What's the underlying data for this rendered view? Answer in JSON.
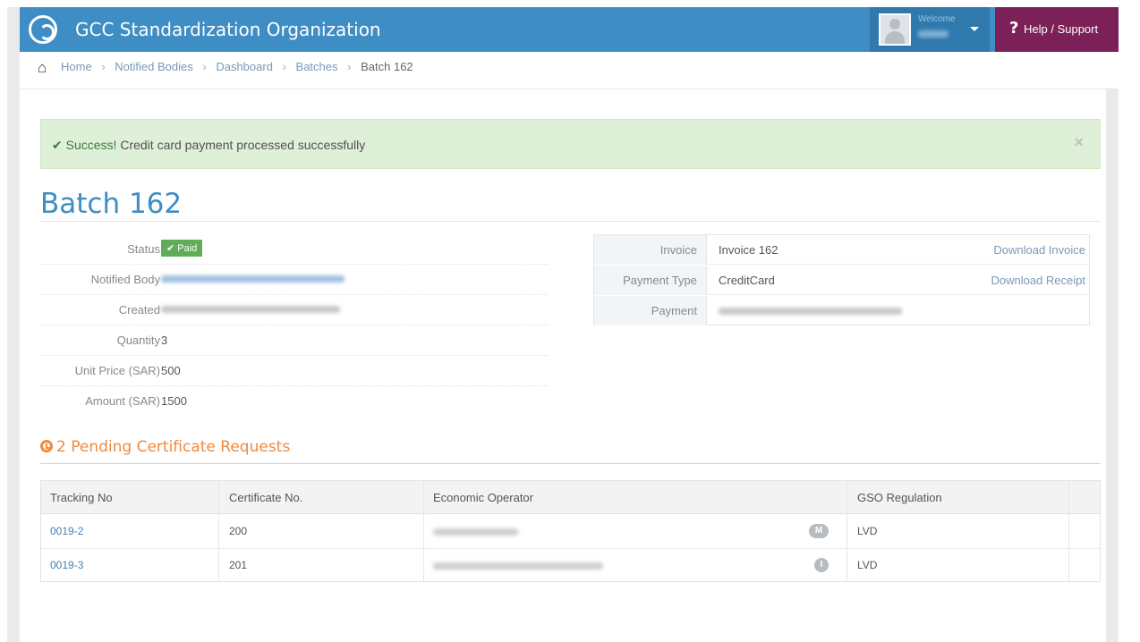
{
  "header": {
    "app_title": "GCC Standardization Organization",
    "welcome_label": "Welcome",
    "help_label": "Help / Support",
    "help_icon": "?"
  },
  "breadcrumb": {
    "items": [
      "Home",
      "Notified Bodies",
      "Dashboard",
      "Batches"
    ],
    "current": "Batch 162",
    "separator": "›"
  },
  "alert": {
    "strong": "Success!",
    "message": "Credit card payment processed successfully",
    "check": "✔",
    "close": "×"
  },
  "batch": {
    "title": "Batch 162",
    "details": {
      "status_label": "Status",
      "status_value": "Paid",
      "notified_body_label": "Notified Body",
      "created_label": "Created",
      "quantity_label": "Quantity",
      "quantity_value": "3",
      "unit_price_label": "Unit Price (SAR)",
      "unit_price_value": "500",
      "amount_label": "Amount (SAR)",
      "amount_value": "1500"
    },
    "invoice": {
      "invoice_label": "Invoice",
      "invoice_value": "Invoice 162",
      "download_invoice": "Download Invoice",
      "payment_type_label": "Payment Type",
      "payment_type_value": "CreditCard",
      "download_receipt": "Download Receipt",
      "payment_label": "Payment"
    }
  },
  "pending": {
    "title": "2 Pending Certificate Requests",
    "columns": [
      "Tracking No",
      "Certificate No.",
      "Economic Operator",
      "GSO Regulation"
    ],
    "rows": [
      {
        "tracking_no": "0019-2",
        "certificate_no": "200",
        "operator_badge": "M",
        "gso_regulation": "LVD"
      },
      {
        "tracking_no": "0019-3",
        "certificate_no": "201",
        "operator_badge": "I",
        "gso_regulation": "LVD"
      }
    ]
  },
  "colors": {
    "topbar": "#3e8dc4",
    "help": "#7b2157",
    "success_bg": "#dff0d8",
    "paid_badge": "#5fad56",
    "pending_accent": "#f08a3c",
    "link": "#7a99b8"
  },
  "icons": {
    "logo": "gso-logo-icon",
    "home": "home-icon",
    "avatar": "user-avatar-icon",
    "caret": "caret-down-icon",
    "help": "question-icon",
    "check": "check-icon",
    "close": "close-icon",
    "clock": "clock-icon"
  }
}
